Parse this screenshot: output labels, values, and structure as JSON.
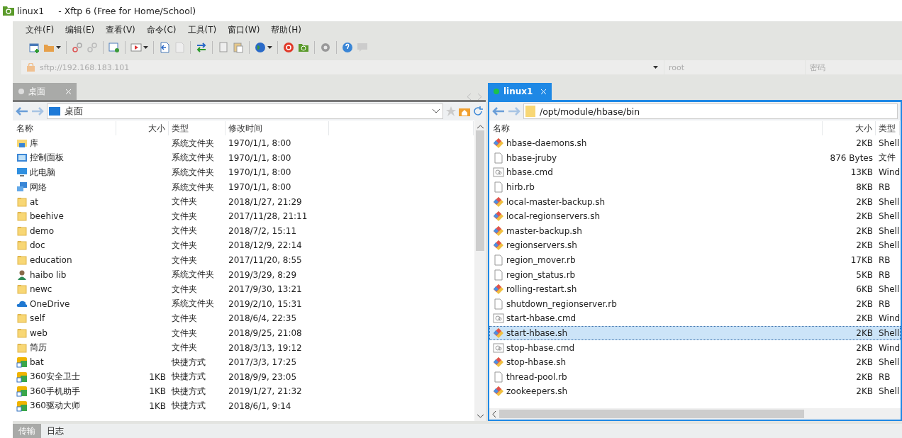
{
  "window": {
    "app_name": "linux1",
    "title": "- Xftp 6 (Free for Home/School)"
  },
  "menu": [
    "文件(F)",
    "编辑(E)",
    "查看(V)",
    "命令(C)",
    "工具(T)",
    "窗口(W)",
    "帮助(H)"
  ],
  "address_bar": {
    "placeholder": "sftp://192.168.183.101",
    "user_placeholder": "root",
    "password_placeholder": "密码"
  },
  "left_pane": {
    "tab": {
      "label": "桌面",
      "selected": false
    },
    "path": "桌面",
    "columns": [
      "名称",
      "大小",
      "类型",
      "修改时间"
    ],
    "rows": [
      {
        "kind": "library",
        "name": "库",
        "size": "",
        "type": "系统文件夹",
        "modified": "1970/1/1, 8:00"
      },
      {
        "kind": "control",
        "name": "控制面板",
        "size": "",
        "type": "系统文件夹",
        "modified": "1970/1/1, 8:00"
      },
      {
        "kind": "pc",
        "name": "此电脑",
        "size": "",
        "type": "系统文件夹",
        "modified": "1970/1/1, 8:00"
      },
      {
        "kind": "network",
        "name": "网络",
        "size": "",
        "type": "系统文件夹",
        "modified": "1970/1/1, 8:00"
      },
      {
        "kind": "folder",
        "name": "at",
        "size": "",
        "type": "文件夹",
        "modified": "2018/1/27, 21:29"
      },
      {
        "kind": "folder",
        "name": "beehive",
        "size": "",
        "type": "文件夹",
        "modified": "2017/11/28, 21:11"
      },
      {
        "kind": "folder",
        "name": "demo",
        "size": "",
        "type": "文件夹",
        "modified": "2018/7/2, 15:11"
      },
      {
        "kind": "folder",
        "name": "doc",
        "size": "",
        "type": "文件夹",
        "modified": "2018/12/9, 22:14"
      },
      {
        "kind": "folder",
        "name": "education",
        "size": "",
        "type": "文件夹",
        "modified": "2017/11/20, 8:55"
      },
      {
        "kind": "user",
        "name": "haibo lib",
        "size": "",
        "type": "系统文件夹",
        "modified": "2019/3/29, 8:29"
      },
      {
        "kind": "folder",
        "name": "newc",
        "size": "",
        "type": "文件夹",
        "modified": "2017/9/30, 13:21"
      },
      {
        "kind": "cloud",
        "name": "OneDrive",
        "size": "",
        "type": "系统文件夹",
        "modified": "2019/2/10, 15:31"
      },
      {
        "kind": "folder",
        "name": "self",
        "size": "",
        "type": "文件夹",
        "modified": "2018/6/4, 22:35"
      },
      {
        "kind": "folder",
        "name": "web",
        "size": "",
        "type": "文件夹",
        "modified": "2018/9/25, 21:08"
      },
      {
        "kind": "folder",
        "name": "简历",
        "size": "",
        "type": "文件夹",
        "modified": "2018/3/13, 19:12"
      },
      {
        "kind": "shortcut",
        "name": "bat",
        "size": "",
        "type": "快捷方式",
        "modified": "2017/3/3, 17:25"
      },
      {
        "kind": "shortcut",
        "name": "360安全卫士",
        "size": "1KB",
        "type": "快捷方式",
        "modified": "2018/9/9, 23:05"
      },
      {
        "kind": "shortcut",
        "name": "360手机助手",
        "size": "1KB",
        "type": "快捷方式",
        "modified": "2019/1/27, 21:32"
      },
      {
        "kind": "shortcut",
        "name": "360驱动大师",
        "size": "1KB",
        "type": "快捷方式",
        "modified": "2018/6/1, 9:14"
      }
    ]
  },
  "right_pane": {
    "tab": {
      "label": "linux1",
      "selected": true
    },
    "path": "/opt/module/hbase/bin",
    "columns": [
      "名称",
      "大小",
      "类型"
    ],
    "rows": [
      {
        "kind": "script",
        "name": "hbase-daemons.sh",
        "size": "2KB",
        "type": "Shell",
        "selected": false
      },
      {
        "kind": "file",
        "name": "hbase-jruby",
        "size": "876 Bytes",
        "type": "文件",
        "selected": false
      },
      {
        "kind": "cmd",
        "name": "hbase.cmd",
        "size": "13KB",
        "type": "Wind",
        "selected": false
      },
      {
        "kind": "file",
        "name": "hirb.rb",
        "size": "8KB",
        "type": "RB",
        "selected": false
      },
      {
        "kind": "script",
        "name": "local-master-backup.sh",
        "size": "2KB",
        "type": "Shell",
        "selected": false
      },
      {
        "kind": "script",
        "name": "local-regionservers.sh",
        "size": "2KB",
        "type": "Shell",
        "selected": false
      },
      {
        "kind": "script",
        "name": "master-backup.sh",
        "size": "2KB",
        "type": "Shell",
        "selected": false
      },
      {
        "kind": "script",
        "name": "regionservers.sh",
        "size": "2KB",
        "type": "Shell",
        "selected": false
      },
      {
        "kind": "file",
        "name": "region_mover.rb",
        "size": "17KB",
        "type": "RB",
        "selected": false
      },
      {
        "kind": "file",
        "name": "region_status.rb",
        "size": "5KB",
        "type": "RB",
        "selected": false
      },
      {
        "kind": "script",
        "name": "rolling-restart.sh",
        "size": "6KB",
        "type": "Shell",
        "selected": false
      },
      {
        "kind": "file",
        "name": "shutdown_regionserver.rb",
        "size": "2KB",
        "type": "RB",
        "selected": false
      },
      {
        "kind": "cmd",
        "name": "start-hbase.cmd",
        "size": "2KB",
        "type": "Wind",
        "selected": false
      },
      {
        "kind": "script",
        "name": "start-hbase.sh",
        "size": "2KB",
        "type": "Shell",
        "selected": true
      },
      {
        "kind": "cmd",
        "name": "stop-hbase.cmd",
        "size": "2KB",
        "type": "Wind",
        "selected": false
      },
      {
        "kind": "script",
        "name": "stop-hbase.sh",
        "size": "2KB",
        "type": "Shell",
        "selected": false
      },
      {
        "kind": "file",
        "name": "thread-pool.rb",
        "size": "2KB",
        "type": "RB",
        "selected": false
      },
      {
        "kind": "script",
        "name": "zookeepers.sh",
        "size": "2KB",
        "type": "Shell",
        "selected": false
      }
    ]
  },
  "bottom_tabs": [
    {
      "label": "传输",
      "selected": true
    },
    {
      "label": "日志",
      "selected": false
    }
  ]
}
